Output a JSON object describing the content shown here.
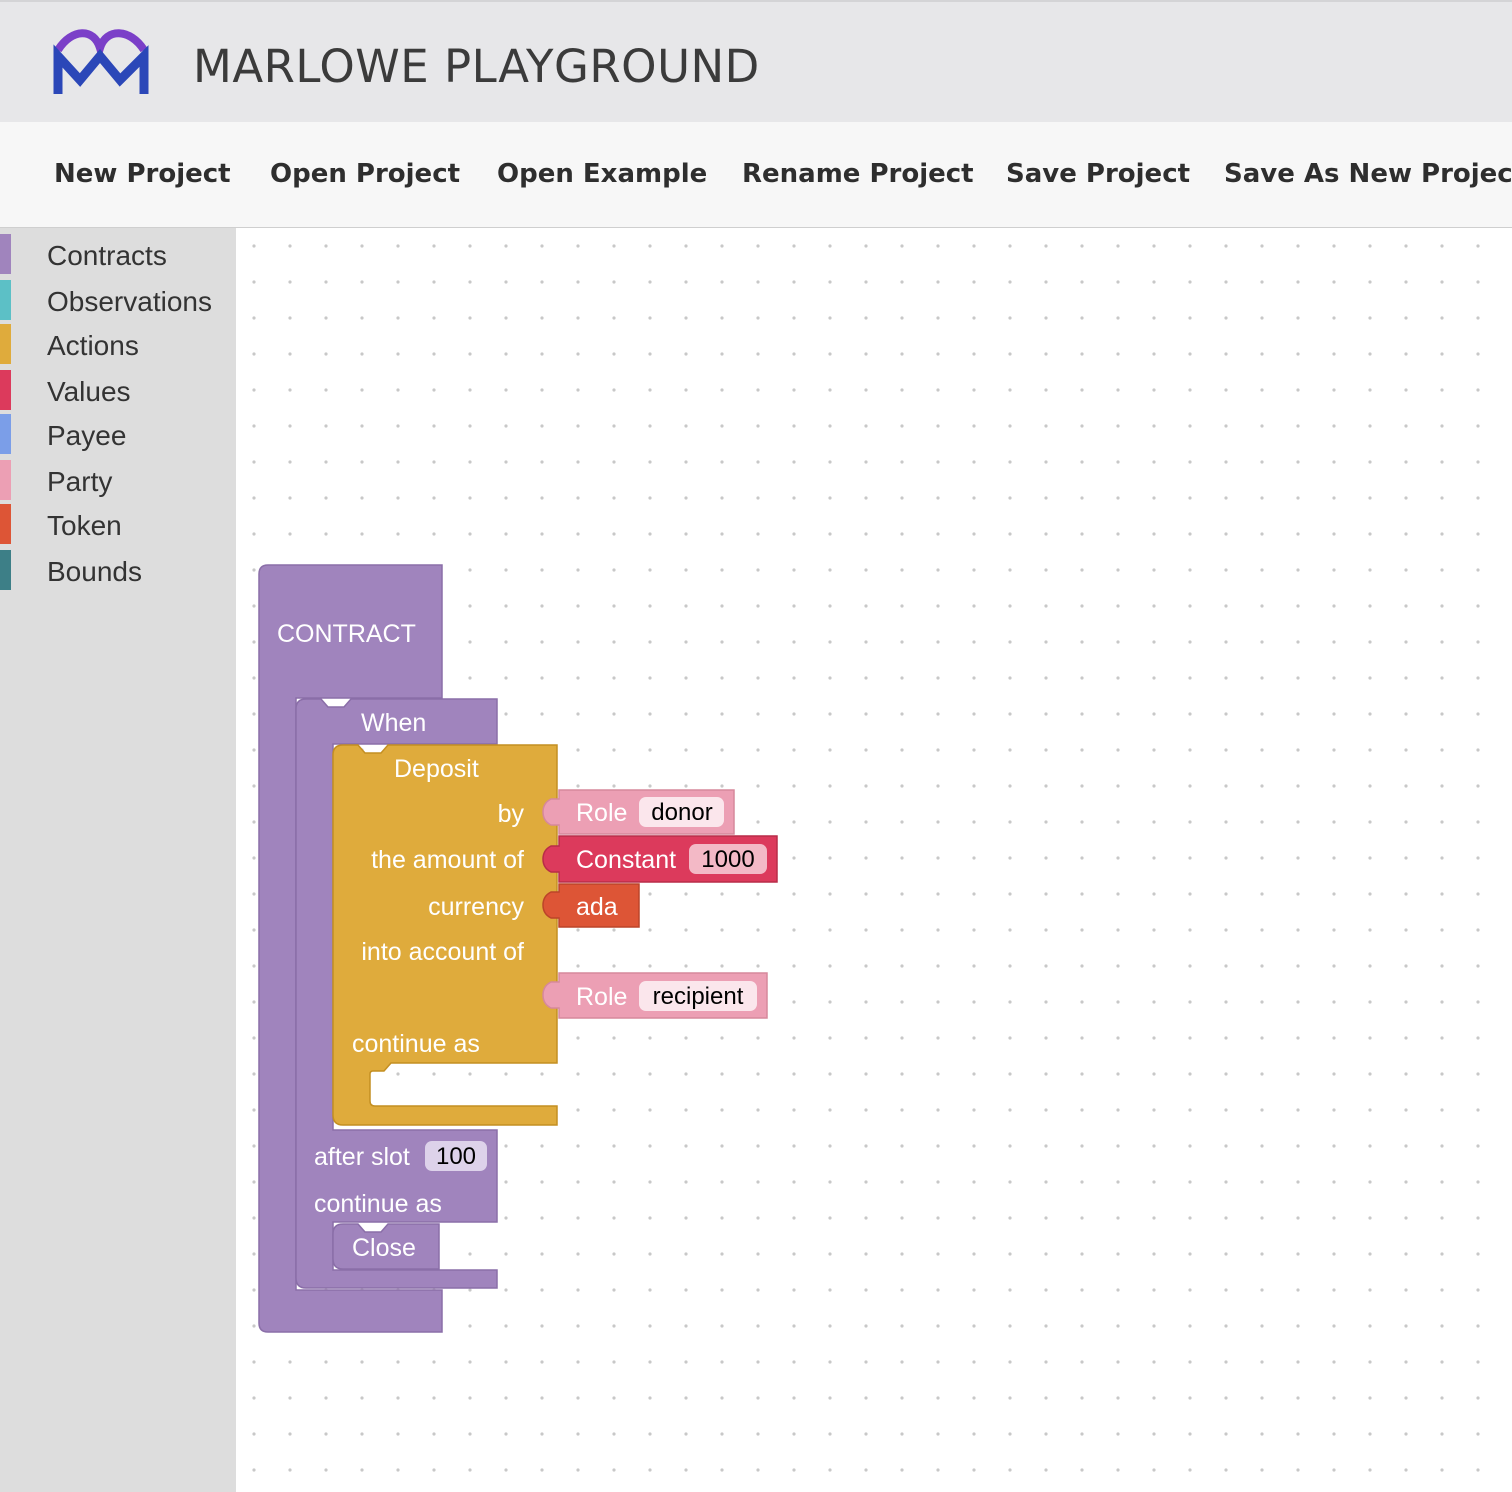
{
  "app": {
    "title": "MARLOWE PLAYGROUND",
    "logo_icon": "marlowe-logo-icon",
    "logo_colors": {
      "top": "#7b3fc8",
      "bottom": "#2b47b8"
    }
  },
  "menu": {
    "new_project": "New Project",
    "open_project": "Open Project",
    "open_example": "Open Example",
    "rename_project": "Rename Project",
    "save_project": "Save Project",
    "save_as_new_project": "Save As New Project"
  },
  "toolbox": {
    "categories": [
      {
        "label": "Contracts",
        "color": "#a084bd"
      },
      {
        "label": "Observations",
        "color": "#5cc0c6"
      },
      {
        "label": "Actions",
        "color": "#dfab3c"
      },
      {
        "label": "Values",
        "color": "#dc3a5c"
      },
      {
        "label": "Payee",
        "color": "#7b9ee8"
      },
      {
        "label": "Party",
        "color": "#ec9fb4"
      },
      {
        "label": "Token",
        "color": "#dd5536"
      },
      {
        "label": "Bounds",
        "color": "#3d7f87"
      }
    ]
  },
  "blocks": {
    "contract": {
      "label": "CONTRACT",
      "color": "#a084bd"
    },
    "when": {
      "label": "When",
      "after_slot_label": "after slot",
      "timeout": "100",
      "continue_label": "continue as",
      "color": "#a084bd"
    },
    "deposit": {
      "label": "Deposit",
      "by_label": "by",
      "amount_label": "the amount of",
      "currency_label": "currency",
      "account_label": "into account of",
      "continue_label": "continue as",
      "color": "#dfab3c"
    },
    "role_donor": {
      "label": "Role",
      "value": "donor",
      "color": "#ec9fb4"
    },
    "constant": {
      "label": "Constant",
      "value": "1000",
      "color": "#dc3a5c"
    },
    "ada": {
      "label": "ada",
      "color": "#dd5536"
    },
    "role_recipient": {
      "label": "Role",
      "value": "recipient",
      "color": "#ec9fb4"
    },
    "close": {
      "label": "Close",
      "color": "#a084bd"
    }
  }
}
